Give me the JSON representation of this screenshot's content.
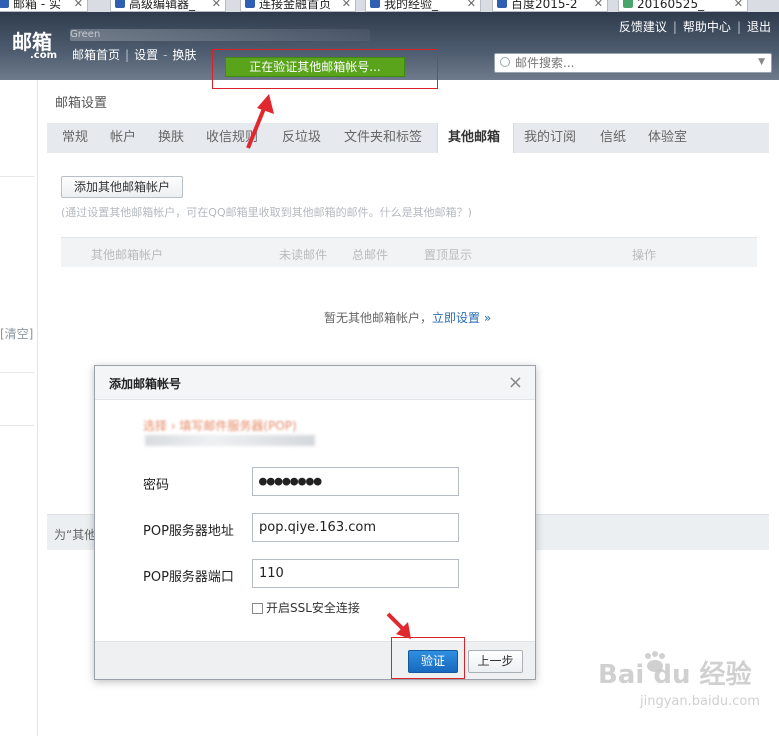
{
  "browser": {
    "tabs": [
      {
        "label": "邮箱 - 实"
      },
      {
        "label": "高级编辑器_"
      },
      {
        "label": "连接金融首页"
      },
      {
        "label": "我的经验_"
      },
      {
        "label": "百度2015-2"
      },
      {
        "label": "20160525_"
      }
    ]
  },
  "header": {
    "logo": "邮箱",
    "logo_sub": ".com",
    "account": "Green",
    "nav": [
      "邮箱首页",
      "设置",
      "换肤"
    ],
    "links": [
      "反馈建议",
      "帮助中心",
      "退出"
    ],
    "status_banner": "正在验证其他邮箱帐号...",
    "search_placeholder": "邮件搜索..."
  },
  "sidebar": {
    "clear": "[清空]"
  },
  "settings": {
    "title": "邮箱设置",
    "tabs": [
      "常规",
      "帐户",
      "换肤",
      "收信规则",
      "反垃圾",
      "文件夹和标签",
      "其他邮箱",
      "我的订阅",
      "信纸",
      "体验室"
    ],
    "active_tab": "其他邮箱",
    "add_button": "添加其他邮箱帐户",
    "hint": "(通过设置其他邮箱帐户，可在QQ邮箱里收取到其他邮箱的邮件。什么是其他邮箱？)",
    "columns": [
      "其他邮箱帐户",
      "未读邮件",
      "总邮件",
      "置顶显示",
      "操作"
    ],
    "empty_text": "暂无其他邮箱帐户，",
    "empty_link": "立即设置 »",
    "footer_text": "为“其他"
  },
  "dialog": {
    "title": "添加邮箱帐号",
    "breadcrumb": "选择 › 填写邮件服务器(POP)",
    "fields": {
      "password_label": "密码",
      "password_value": "●●●●●●●●",
      "server_label": "POP服务器地址",
      "server_value": "pop.qiye.163.com",
      "port_label": "POP服务器端口",
      "port_value": "110"
    },
    "ssl_label": "开启SSL安全连接",
    "verify_button": "验证",
    "prev_button": "上一步"
  },
  "watermark": {
    "brand": "Bai  du 经验",
    "url": "jingyan.baidu.com"
  },
  "colors": {
    "annotation": "#d9232a",
    "status_green": "#5aa41c",
    "primary_blue": "#1769bf"
  }
}
